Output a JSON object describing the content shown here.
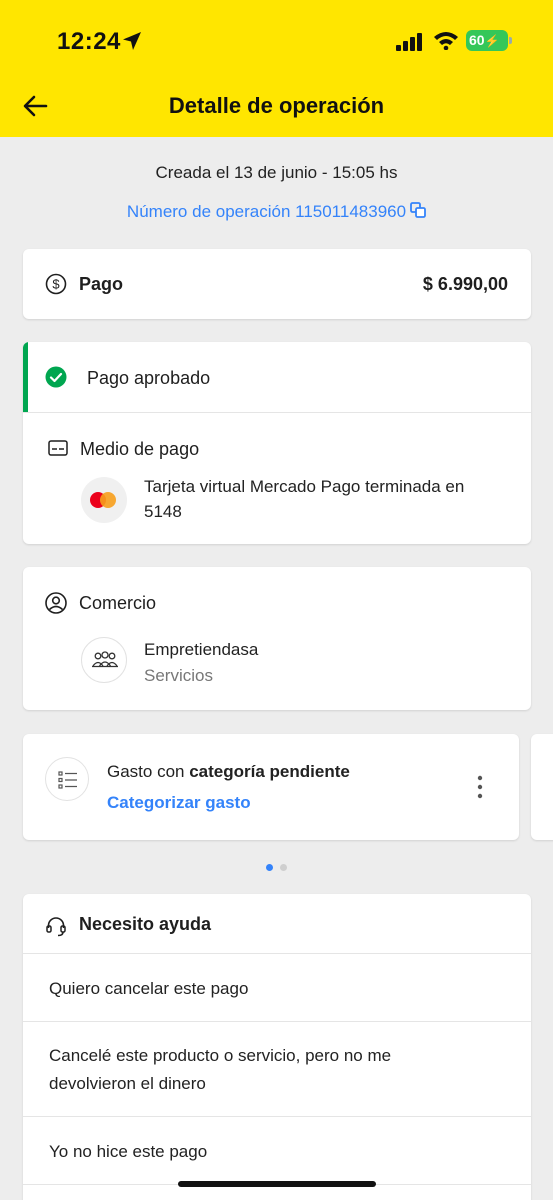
{
  "status_bar": {
    "time": "12:24",
    "battery": "60"
  },
  "header": {
    "title": "Detalle de operación"
  },
  "meta": {
    "created": "Creada el 13 de junio - 15:05 hs",
    "operation_number": "Número de operación 115011483960"
  },
  "payment": {
    "label": "Pago",
    "amount": "$ 6.990,00"
  },
  "status": {
    "label": "Pago aprobado",
    "color": "#00a650",
    "method_title": "Medio de pago",
    "method_line1": "Tarjeta virtual Mercado Pago terminada en",
    "method_line2": "5148"
  },
  "merchant": {
    "title": "Comercio",
    "name": "Empretiendasa",
    "category": "Servicios"
  },
  "expense": {
    "prefix": "Gasto con ",
    "emphasis": "categoría pendiente",
    "action": "Categorizar gasto"
  },
  "help": {
    "title": "Necesito ayuda",
    "items": [
      {
        "line1": "Quiero cancelar este pago",
        "line2": ""
      },
      {
        "line1": "Cancelé este producto o servicio, pero no me",
        "line2": "devolvieron el dinero"
      },
      {
        "line1": "Yo no hice este pago",
        "line2": ""
      }
    ]
  },
  "colors": {
    "brand_yellow": "#ffe600",
    "link_blue": "#3483fa",
    "success_green": "#00a650"
  }
}
